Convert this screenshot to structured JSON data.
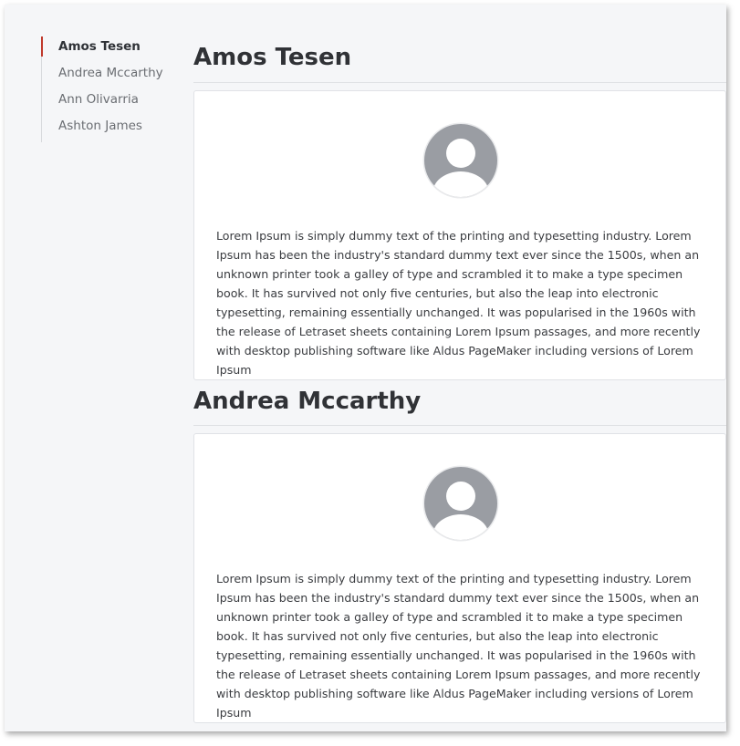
{
  "sidebar": {
    "items": [
      {
        "label": "Amos Tesen",
        "active": true
      },
      {
        "label": "Andrea Mccarthy",
        "active": false
      },
      {
        "label": "Ann Olivarria",
        "active": false
      },
      {
        "label": "Ashton James",
        "active": false
      }
    ]
  },
  "profiles": [
    {
      "name": "Amos Tesen",
      "bio": "Lorem Ipsum is simply dummy text of the printing and typesetting industry. Lorem Ipsum has been the industry's standard dummy text ever since the 1500s, when an unknown printer took a galley of type and scrambled it to make a type specimen book. It has survived not only five centuries, but also the leap into electronic typesetting, remaining essentially unchanged. It was popularised in the 1960s with the release of Letraset sheets containing Lorem Ipsum passages, and more recently with desktop publishing software like Aldus PageMaker including versions of Lorem Ipsum",
      "avatar_icon": "user-avatar-icon"
    },
    {
      "name": "Andrea Mccarthy",
      "bio": "Lorem Ipsum is simply dummy text of the printing and typesetting industry. Lorem Ipsum has been the industry's standard dummy text ever since the 1500s, when an unknown printer took a galley of type and scrambled it to make a type specimen book. It has survived not only five centuries, but also the leap into electronic typesetting, remaining essentially unchanged. It was popularised in the 1960s with the release of Letraset sheets containing Lorem Ipsum passages, and more recently with desktop publishing software like Aldus PageMaker including versions of Lorem Ipsum",
      "avatar_icon": "user-avatar-icon"
    }
  ],
  "colors": {
    "accent": "#c0392b",
    "background": "#f5f6f8",
    "avatar": "#9a9da3"
  }
}
